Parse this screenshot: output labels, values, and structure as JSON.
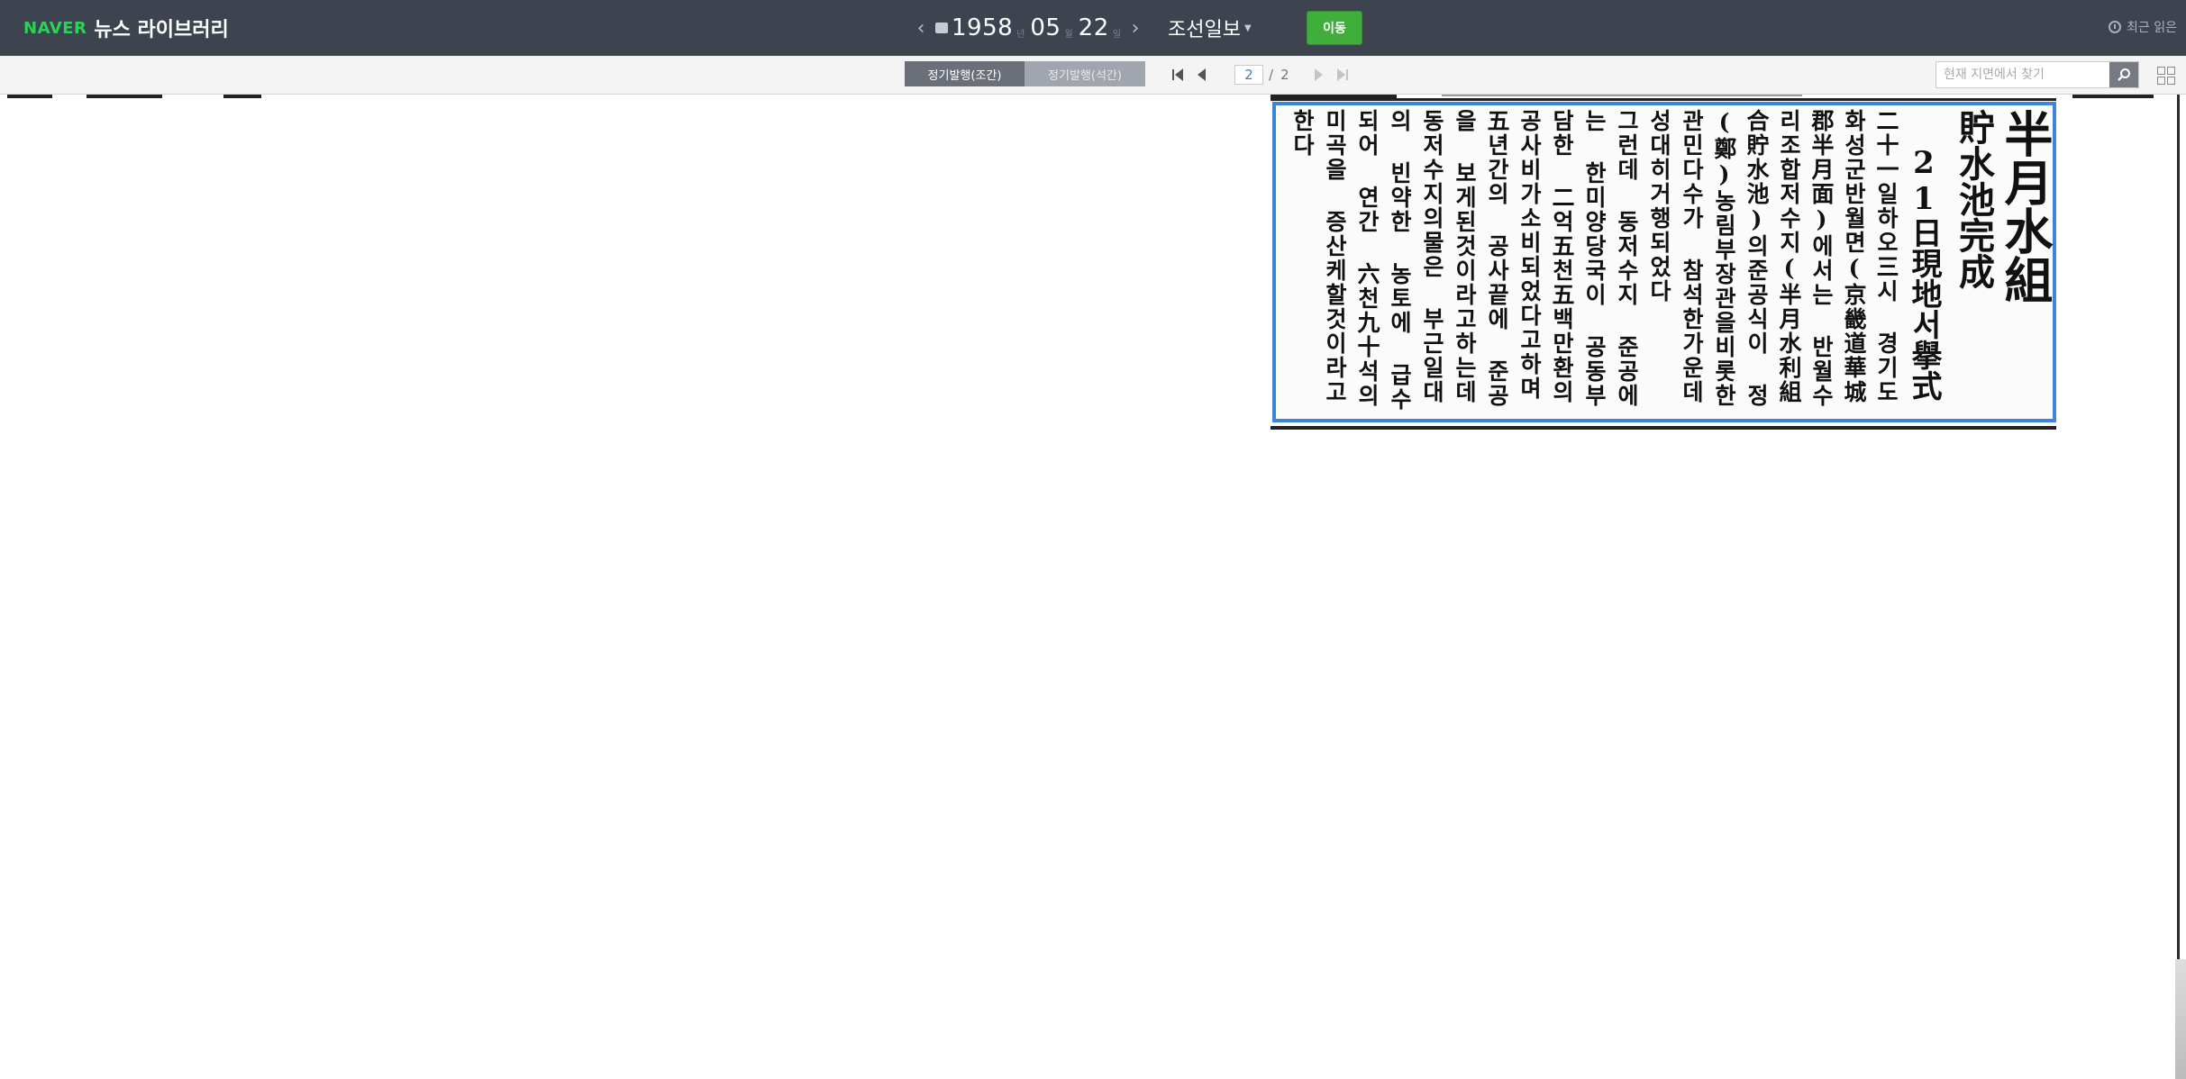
{
  "header": {
    "logo_brand": "NAVER",
    "logo_service": "뉴스 라이브러리",
    "date": {
      "year": "1958",
      "month": "05",
      "day": "22",
      "year_unit": "년",
      "month_unit": "월",
      "day_unit": "일"
    },
    "prev_icon": "chevron-left-icon",
    "next_icon": "chevron-right-icon",
    "newspaper": "조선일보",
    "go_label": "이동",
    "recent_label": "최근 읽은"
  },
  "toolbar": {
    "tabs": [
      {
        "label": "정기발행(조간)",
        "active": true
      },
      {
        "label": "정기발행(석간)",
        "active": false
      }
    ],
    "page_current": "2",
    "page_separator": "/",
    "page_total": "2",
    "search_placeholder": "현재 지면에서 찾기"
  },
  "article": {
    "highlight_color": "#3d84dd",
    "headline": "半月水組",
    "subhead": "貯水池完成",
    "dateline": "21日現地서擧式",
    "body_columns": [
      "二十一일하오三시 경기도",
      "화성군반월면(京畿道華城",
      "郡半月面)에서는 반월수",
      "리조합저수지(半月水利組",
      "合貯水池)의준공식이 정",
      "(鄭)농림부장관을비롯한",
      "관민다수가 참석한가운데",
      "성대히거행되었다",
      "그런데 동저수지 준공에",
      "는 한미양당국이 공동부",
      "담한 二억五천五백만환의",
      "공사비가소비되었다고하며",
      "五년간의 공사끝에 준공",
      "을 보게된것이라고하는데",
      "동저수지의물은 부근일대",
      "의 빈약한 농토에 급수",
      "되어 연간 六천九十석의",
      "미곡을 증산케할것이라고",
      "한다"
    ]
  }
}
